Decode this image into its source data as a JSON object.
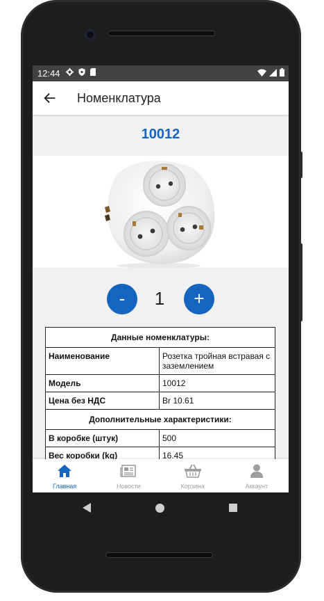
{
  "status_bar": {
    "time": "12:44"
  },
  "app_bar": {
    "title": "Номенклатура"
  },
  "product": {
    "code": "10012"
  },
  "quantity": {
    "minus_label": "-",
    "value": "1",
    "plus_label": "+"
  },
  "details_table": {
    "section1_header": "Данные номенклатуры:",
    "rows1": [
      {
        "key": "Наименование",
        "value": "Розетка тройная встравая с заземлением"
      },
      {
        "key": "Модель",
        "value": "10012"
      },
      {
        "key": "Цена без НДС",
        "value": "Br 10.61"
      }
    ],
    "section2_header": "Дополнительные характеристики:",
    "rows2": [
      {
        "key": "В коробке (штук)",
        "value": "500"
      },
      {
        "key": "Вес коробки (kg)",
        "value": "16.45"
      }
    ]
  },
  "bottom_nav": [
    {
      "label": "Главная",
      "icon": "home-icon",
      "active": true
    },
    {
      "label": "Новости",
      "icon": "newspaper-icon",
      "active": false
    },
    {
      "label": "Корзина",
      "icon": "basket-icon",
      "active": false
    },
    {
      "label": "Аккаунт",
      "icon": "user-icon",
      "active": false
    }
  ],
  "colors": {
    "accent": "#1565c0",
    "statusbar": "#424242"
  }
}
